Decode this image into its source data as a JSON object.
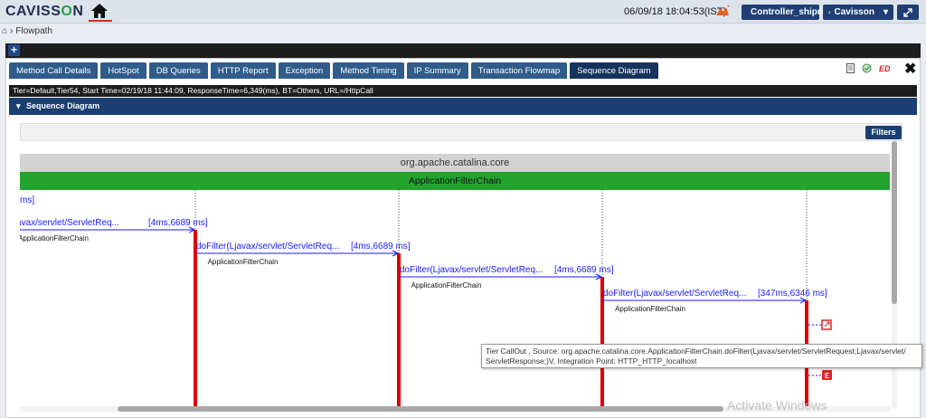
{
  "header": {
    "logo_prefix": "CAVISS",
    "logo_o": "O",
    "logo_suffix": "N",
    "datetime": "06/09/18 18:04:53(IST)",
    "controller": "Controller_shipra",
    "user": "Cavisson"
  },
  "breadcrumb": {
    "page": "Flowpath"
  },
  "tabs": [
    "Method Call Details",
    "HotSpot",
    "DB Queries",
    "HTTP Report",
    "Exception",
    "Method Timing",
    "IP Summary",
    "Transaction Flowmap",
    "Sequence Diagram"
  ],
  "active_tab": "Sequence Diagram",
  "info_bar": "Tier=Default,Tier54, Start Time=02/19/18 11:44:09, ResponseTime=6,349(ms), BT=Others, URL=/HttpCall",
  "section_title": "Sequence Diagram",
  "filters_label": "Filters",
  "diagram": {
    "package": "org.apache.catalina.core",
    "class_name": "ApplicationFilterChain",
    "first_label": "ms]",
    "calls": [
      {
        "method": "lter(Ljavax/servlet/ServletReq...",
        "timing": "[4ms,6689 ms]",
        "target": "ApplicationFilterChain"
      },
      {
        "method": "doFilter(Ljavax/servlet/ServletReq...",
        "timing": "[4ms,6689 ms]",
        "target": "ApplicationFilterChain"
      },
      {
        "method": "doFilter(Ljavax/servlet/ServletReq...",
        "timing": "[4ms,6689 ms]",
        "target": "ApplicationFilterChain"
      },
      {
        "method": "doFilter(Ljavax/servlet/ServletReq...",
        "timing": "[347ms,6346 ms]",
        "target": "ApplicationFilterChain"
      }
    ],
    "exception_badge": "E"
  },
  "tooltip": {
    "line1": "Tier CallOut , Source: org.apache.catalina.core.ApplicationFilterChain.doFilter(Ljavax/servlet/ServletRequest;Ljavax/servlet/",
    "line2": "ServletResponse;)V, Integration Point: HTTP_HTTP_localhost"
  },
  "watermark": "Activate Windows",
  "colors": {
    "accent": "#1a3f70",
    "class_bar": "#22a42f",
    "lifeline_active": "#e00000",
    "call_text": "#1a1aff"
  }
}
